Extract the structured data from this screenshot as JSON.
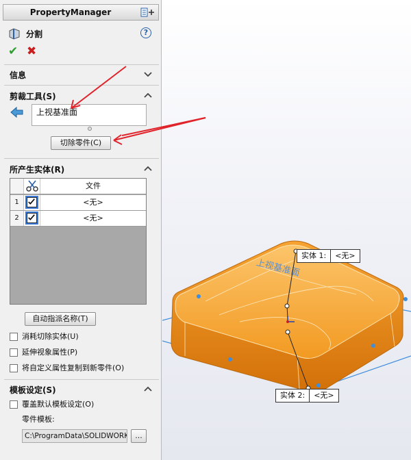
{
  "panel": {
    "title": "PropertyManager",
    "feature_name": "分割",
    "help_icon": "?",
    "ok_icon": "✔",
    "cancel_icon": "✖"
  },
  "sections": {
    "info": {
      "title": "信息"
    },
    "trim_tools": {
      "title": "剪裁工具(S)",
      "selected_item": "上视基准面",
      "cut_button": "切除零件(C)"
    },
    "resulting_bodies": {
      "title": "所产生实体(R)",
      "column_file": "文件",
      "rows": [
        {
          "num": "1",
          "file": "<无>"
        },
        {
          "num": "2",
          "file": "<无>"
        }
      ],
      "auto_assign_button": "自动指派名称(T)",
      "options": [
        "消耗切除实体(U)",
        "延伸视象属性(P)",
        "将自定义属性复制到新零件(O)"
      ]
    },
    "template": {
      "title": "模板设定(S)",
      "override_option": "覆盖默认模板设定(O)",
      "part_template_label": "零件模板:",
      "path": "C:\\ProgramData\\SOLIDWORKS\\",
      "browse_button": "..."
    }
  },
  "graphics": {
    "callouts": [
      {
        "key": "实体 1:",
        "value": "<无>"
      },
      {
        "key": "实体 2:",
        "value": "<无>"
      }
    ],
    "engraved_text": "上视基准面"
  },
  "colors": {
    "part_orange": "#f7a331",
    "arrow_red": "#e0242b",
    "plane_blue": "#3f8ddc"
  }
}
